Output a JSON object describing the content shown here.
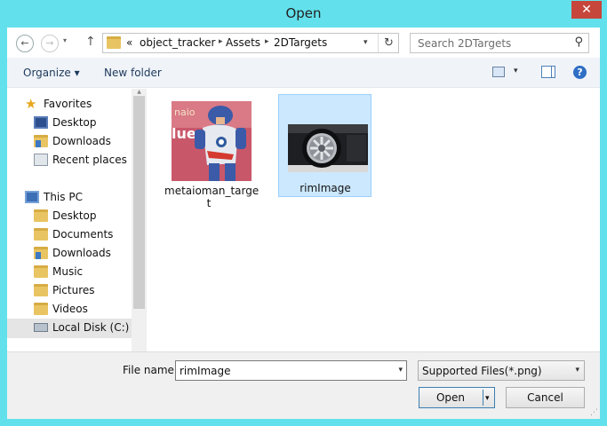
{
  "window": {
    "title": "Open",
    "close_label": "✕"
  },
  "nav": {
    "back_glyph": "←",
    "forward_glyph": "→",
    "recent_glyph": "▾",
    "up_glyph": "↑",
    "breadcrumb": [
      "«",
      "object_tracker",
      "Assets",
      "2DTargets"
    ],
    "refresh_glyph": "↻",
    "search_placeholder": "Search 2DTargets",
    "search_glyph": "⚲"
  },
  "toolbar": {
    "organize_label": "Organize ▾",
    "new_folder_label": "New folder",
    "view_dd": "▾",
    "help_glyph": "?"
  },
  "sidebar": {
    "favorites": {
      "label": "Favorites",
      "icon": "star-icon"
    },
    "favorite_items": [
      {
        "label": "Desktop",
        "icon": "desktop-icon"
      },
      {
        "label": "Downloads",
        "icon": "downloads-folder-icon"
      },
      {
        "label": "Recent places",
        "icon": "recent-places-icon"
      }
    ],
    "this_pc": {
      "label": "This PC",
      "icon": "computer-icon"
    },
    "pc_items": [
      {
        "label": "Desktop",
        "icon": "folder-icon"
      },
      {
        "label": "Documents",
        "icon": "folder-icon"
      },
      {
        "label": "Downloads",
        "icon": "folder-icon"
      },
      {
        "label": "Music",
        "icon": "folder-icon"
      },
      {
        "label": "Pictures",
        "icon": "folder-icon"
      },
      {
        "label": "Videos",
        "icon": "folder-icon"
      },
      {
        "label": "Local Disk (C:)",
        "icon": "drive-icon"
      }
    ]
  },
  "files": [
    {
      "name_line1": "metaioman_targe",
      "name_line2": "t",
      "thumb_text": "naio\nlue",
      "selected": false
    },
    {
      "name_line1": "rimImage",
      "name_line2": "",
      "selected": true
    }
  ],
  "footer": {
    "file_name_label": "File name:",
    "file_name_value": "rimImage",
    "filter_value": "Supported Files(*.png)",
    "open_label": "Open",
    "cancel_label": "Cancel",
    "dd_glyph": "▾"
  }
}
